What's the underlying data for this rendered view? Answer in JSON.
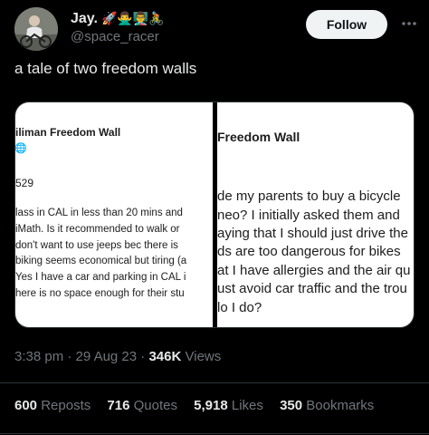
{
  "author": {
    "name": "Jay.",
    "name_emojis": "🚀🙅‍♂️👨‍🏫🚴",
    "handle": "@space_racer"
  },
  "actions": {
    "follow_label": "Follow",
    "more_label": "⋯"
  },
  "tweet": {
    "text": "a tale of two freedom walls"
  },
  "images": {
    "left": {
      "title": "iliman Freedom Wall",
      "globe": "🌐",
      "number": "529",
      "lines": [
        "lass in CAL in less than 20 mins and",
        "iMath. Is it recommended to walk or",
        "don't want to use jeeps bec there is",
        "biking seems economical but tiring (a",
        "Yes I have a car and parking in CAL i",
        "here is no space enough for their stu"
      ]
    },
    "right": {
      "title": "Freedom Wall",
      "lines": [
        "de my parents to buy a bicycle",
        "neo? I initially asked them and",
        "aying that I should just drive the",
        "ds are too dangerous for bikes",
        "at I have allergies and the air qu",
        "ust avoid car traffic and the trou",
        "lo I do?"
      ]
    }
  },
  "meta": {
    "time": "3:38 pm",
    "sep": "·",
    "date": "29 Aug 23",
    "views_count": "346K",
    "views_label": "Views"
  },
  "stats": [
    {
      "count": "600",
      "label": "Reposts"
    },
    {
      "count": "716",
      "label": "Quotes"
    },
    {
      "count": "5,918",
      "label": "Likes"
    },
    {
      "count": "350",
      "label": "Bookmarks"
    }
  ]
}
